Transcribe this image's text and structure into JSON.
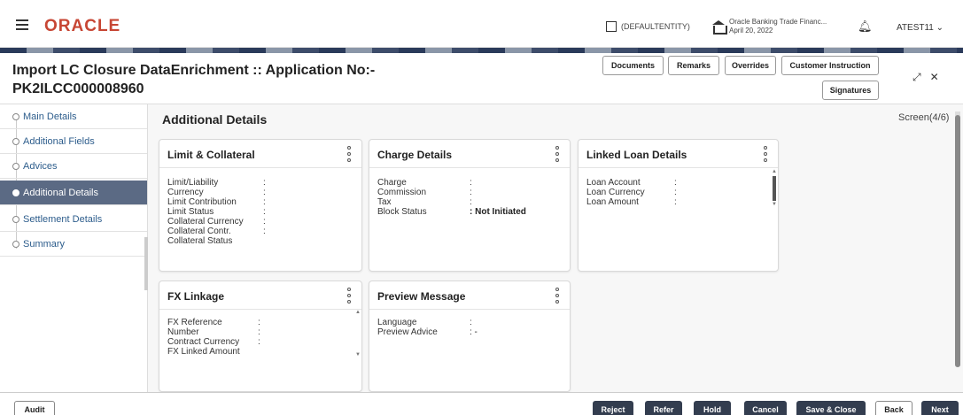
{
  "app": {
    "brand": "ORACLE",
    "entity": "(DEFAULTENTITY)",
    "branch_name": "Oracle Banking Trade Financ...",
    "branch_date": "April 20, 2022",
    "user": "ATEST11"
  },
  "header": {
    "title_line1": "Import LC Closure DataEnrichment :: Application No:-",
    "title_line2": "PK2ILCC000008960",
    "buttons": {
      "documents": "Documents",
      "remarks": "Remarks",
      "overrides": "Overrides",
      "customer_instruction": "Customer Instruction",
      "signatures": "Signatures"
    }
  },
  "sidebar": {
    "items": [
      {
        "label": "Main Details"
      },
      {
        "label": "Additional Fields"
      },
      {
        "label": "Advices"
      },
      {
        "label": "Additional Details"
      },
      {
        "label": "Settlement Details"
      },
      {
        "label": "Summary"
      }
    ]
  },
  "main": {
    "section_title": "Additional Details",
    "screen_indicator": "Screen(4/6)",
    "cards": {
      "limit": {
        "title": "Limit & Collateral",
        "fields": [
          "Limit/Liability",
          "Currency",
          "Limit Contribution",
          "Limit Status",
          "Collateral Currency",
          "Collateral Contr.",
          "Collateral Status"
        ]
      },
      "charge": {
        "title": "Charge Details",
        "fields": [
          "Charge",
          "Commission",
          "Tax",
          "Block Status"
        ],
        "block_status_value": ": Not Initiated"
      },
      "loan": {
        "title": "Linked Loan Details",
        "fields": [
          "Loan Account",
          "Loan Currency",
          "Loan Amount"
        ]
      },
      "fx": {
        "title": "FX Linkage",
        "fields": [
          "FX Reference",
          "Number",
          "Contract Currency",
          "FX Linked Amount"
        ]
      },
      "preview": {
        "title": "Preview Message",
        "fields": [
          "Language",
          "Preview Advice"
        ],
        "preview_advice_value": ": -"
      }
    }
  },
  "footer": {
    "audit": "Audit",
    "reject": "Reject",
    "refer": "Refer",
    "hold": "Hold",
    "cancel": "Cancel",
    "save_close": "Save & Close",
    "back": "Back",
    "next": "Next"
  },
  "colors": {
    "brand": "#c74634",
    "sidebar_active": "#5b6a84",
    "footer_dark_button": "#333d4f",
    "link": "#2d5d8c"
  }
}
